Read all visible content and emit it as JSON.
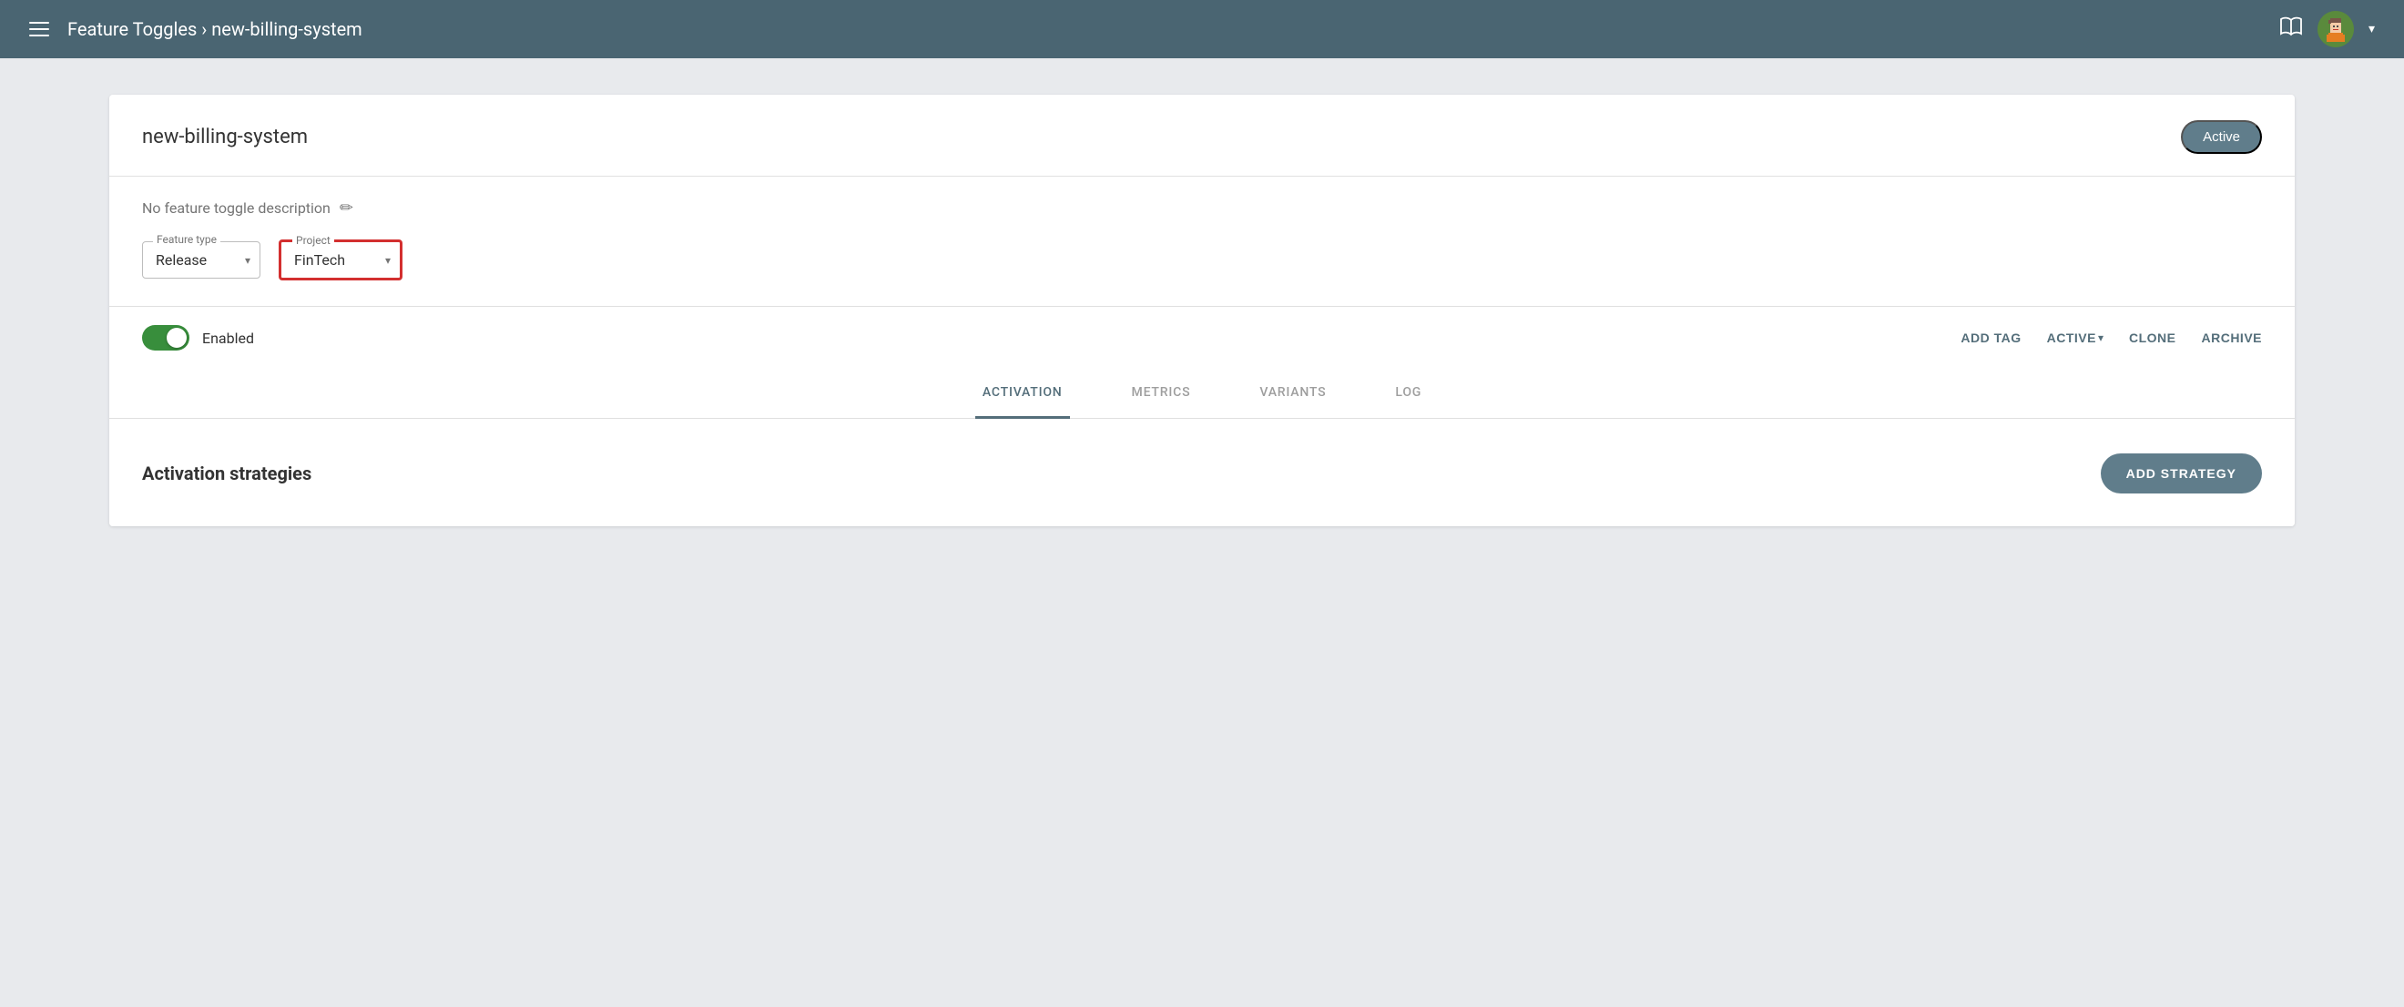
{
  "header": {
    "hamburger_label": "menu",
    "nav_title": "Feature Toggles › new-billing-system",
    "book_icon": "📖",
    "chevron": "▾"
  },
  "card": {
    "feature_name": "new-billing-system",
    "active_badge": "Active",
    "description": "No feature toggle description",
    "edit_icon": "✏",
    "feature_type_label": "Feature type",
    "feature_type_value": "Release",
    "project_label": "Project",
    "project_value": "FinTech",
    "enabled_label": "Enabled",
    "actions": {
      "add_tag": "ADD TAG",
      "active": "ACTIVE",
      "clone": "CLONE",
      "archive": "ARCHIVE"
    }
  },
  "tabs": [
    {
      "label": "ACTIVATION",
      "active": true
    },
    {
      "label": "METRICS",
      "active": false
    },
    {
      "label": "VARIANTS",
      "active": false
    },
    {
      "label": "LOG",
      "active": false
    }
  ],
  "activation": {
    "title": "Activation strategies",
    "add_strategy_btn": "ADD STRATEGY"
  },
  "colors": {
    "header_bg": "#4a6572",
    "active_badge": "#607d8b",
    "toggle_on": "#388e3c",
    "action_color": "#546e7a",
    "add_strategy_bg": "#607d8b"
  }
}
